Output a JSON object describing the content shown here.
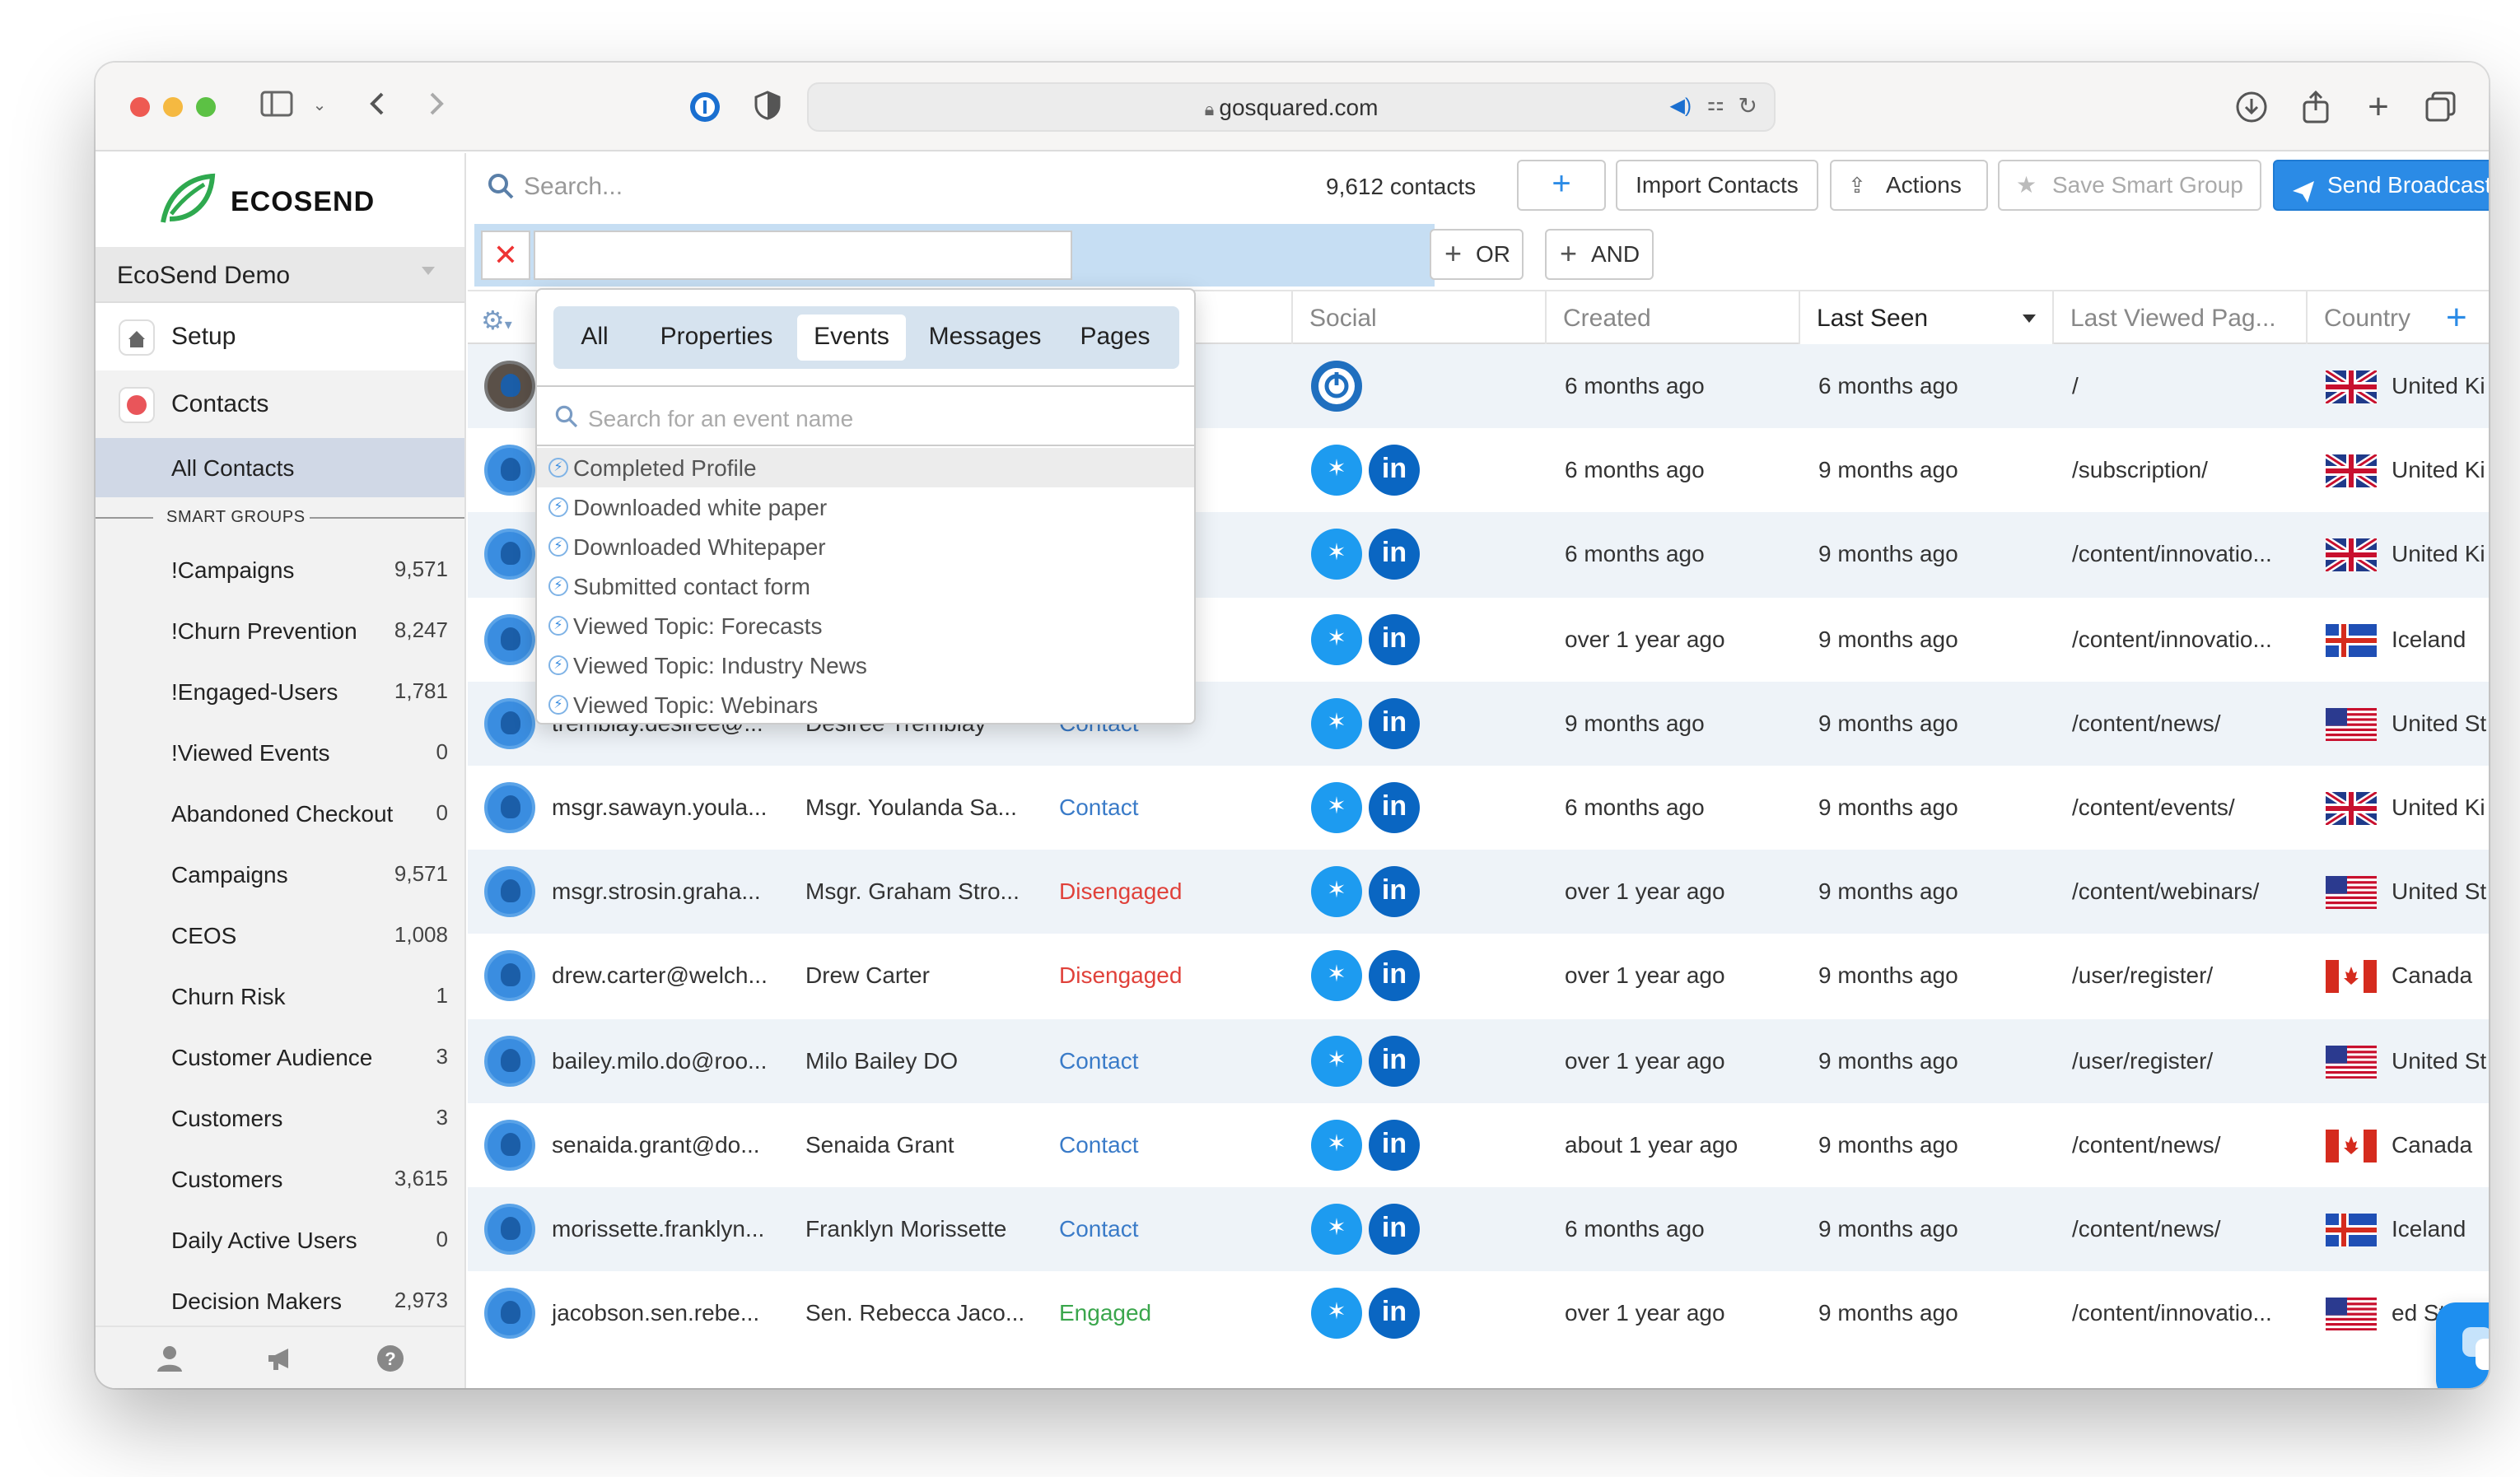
{
  "browser": {
    "url": "gosquared.com"
  },
  "sidebar": {
    "brand": "ECOSEND",
    "workspace": "EcoSend Demo",
    "setup_label": "Setup",
    "contacts_label": "Contacts",
    "all_contacts_label": "All Contacts",
    "smart_groups_heading": "SMART GROUPS",
    "smart_groups": [
      {
        "name": "!Campaigns",
        "count": "9,571"
      },
      {
        "name": "!Churn Prevention",
        "count": "8,247"
      },
      {
        "name": "!Engaged-Users",
        "count": "1,781"
      },
      {
        "name": "!Viewed Events",
        "count": "0"
      },
      {
        "name": "Abandoned Checkout",
        "count": "0"
      },
      {
        "name": "Campaigns",
        "count": "9,571"
      },
      {
        "name": "CEOS",
        "count": "1,008"
      },
      {
        "name": "Churn Risk",
        "count": "1"
      },
      {
        "name": "Customer Audience",
        "count": "3"
      },
      {
        "name": "Customers",
        "count": "3"
      },
      {
        "name": "Customers",
        "count": "3,615"
      },
      {
        "name": "Daily Active Users",
        "count": "0"
      },
      {
        "name": "Decision Makers",
        "count": "2,973"
      }
    ]
  },
  "toolbar": {
    "search_placeholder": "Search...",
    "contact_count": "9,612 contacts",
    "add_label": "+",
    "import_label": "Import Contacts",
    "actions_label": "Actions",
    "save_smart_group_label": "Save Smart Group",
    "send_broadcast_label": "Send Broadcast"
  },
  "filter": {
    "clear_label": "✕",
    "or_label": "OR",
    "and_label": "AND"
  },
  "table": {
    "columns": [
      "Social",
      "Created",
      "Last Seen",
      "Last Viewed Pag...",
      "Country"
    ],
    "rows": [
      {
        "email": "",
        "name": "",
        "status": "",
        "status_color": "#3a7bc8",
        "created": "6 months ago",
        "last_seen": "6 months ago",
        "page": "/",
        "country": "United Ki",
        "flag": "uk"
      },
      {
        "email": "",
        "name": "",
        "status": "",
        "status_color": "#3a7bc8",
        "created": "6 months ago",
        "last_seen": "9 months ago",
        "page": "/subscription/",
        "country": "United Ki",
        "flag": "uk"
      },
      {
        "email": "",
        "name": "",
        "status": "",
        "status_color": "#3a7bc8",
        "created": "6 months ago",
        "last_seen": "9 months ago",
        "page": "/content/innovatio...",
        "country": "United Ki",
        "flag": "uk"
      },
      {
        "email": "",
        "name": "",
        "status": "",
        "status_color": "#3a7bc8",
        "created": "over 1 year ago",
        "last_seen": "9 months ago",
        "page": "/content/innovatio...",
        "country": "Iceland",
        "flag": "is"
      },
      {
        "email": "tremblay.desiree@...",
        "name": "Desiree Tremblay",
        "status": "Contact",
        "status_color": "#3a7bc8",
        "created": "9 months ago",
        "last_seen": "9 months ago",
        "page": "/content/news/",
        "country": "United St",
        "flag": "us"
      },
      {
        "email": "msgr.sawayn.youla...",
        "name": "Msgr. Youlanda Sa...",
        "status": "Contact",
        "status_color": "#3a7bc8",
        "created": "6 months ago",
        "last_seen": "9 months ago",
        "page": "/content/events/",
        "country": "United Ki",
        "flag": "uk"
      },
      {
        "email": "msgr.strosin.graha...",
        "name": "Msgr. Graham Stro...",
        "status": "Disengaged",
        "status_color": "#e0413a",
        "created": "over 1 year ago",
        "last_seen": "9 months ago",
        "page": "/content/webinars/",
        "country": "United St",
        "flag": "us"
      },
      {
        "email": "drew.carter@welch...",
        "name": "Drew Carter",
        "status": "Disengaged",
        "status_color": "#e0413a",
        "created": "over 1 year ago",
        "last_seen": "9 months ago",
        "page": "/user/register/",
        "country": "Canada",
        "flag": "ca"
      },
      {
        "email": "bailey.milo.do@roo...",
        "name": "Milo Bailey DO",
        "status": "Contact",
        "status_color": "#3a7bc8",
        "created": "over 1 year ago",
        "last_seen": "9 months ago",
        "page": "/user/register/",
        "country": "United St",
        "flag": "us"
      },
      {
        "email": "senaida.grant@do...",
        "name": "Senaida Grant",
        "status": "Contact",
        "status_color": "#3a7bc8",
        "created": "about 1 year ago",
        "last_seen": "9 months ago",
        "page": "/content/news/",
        "country": "Canada",
        "flag": "ca"
      },
      {
        "email": "morissette.franklyn...",
        "name": "Franklyn Morissette",
        "status": "Contact",
        "status_color": "#3a7bc8",
        "created": "6 months ago",
        "last_seen": "9 months ago",
        "page": "/content/news/",
        "country": "Iceland",
        "flag": "is"
      },
      {
        "email": "jacobson.sen.rebe...",
        "name": "Sen. Rebecca Jaco...",
        "status": "Engaged",
        "status_color": "#3aa64c",
        "created": "over 1 year ago",
        "last_seen": "9 months ago",
        "page": "/content/innovatio...",
        "country": "ed St",
        "flag": "us"
      }
    ]
  },
  "dropdown": {
    "tabs": [
      "All",
      "Properties",
      "Events",
      "Messages",
      "Pages"
    ],
    "active_tab": "Events",
    "search_placeholder": "Search for an event name",
    "items": [
      "Completed Profile",
      "Downloaded white paper",
      "Downloaded Whitepaper",
      "Submitted contact form",
      "Viewed Topic: Forecasts",
      "Viewed Topic: Industry News",
      "Viewed Topic: Webinars"
    ]
  }
}
